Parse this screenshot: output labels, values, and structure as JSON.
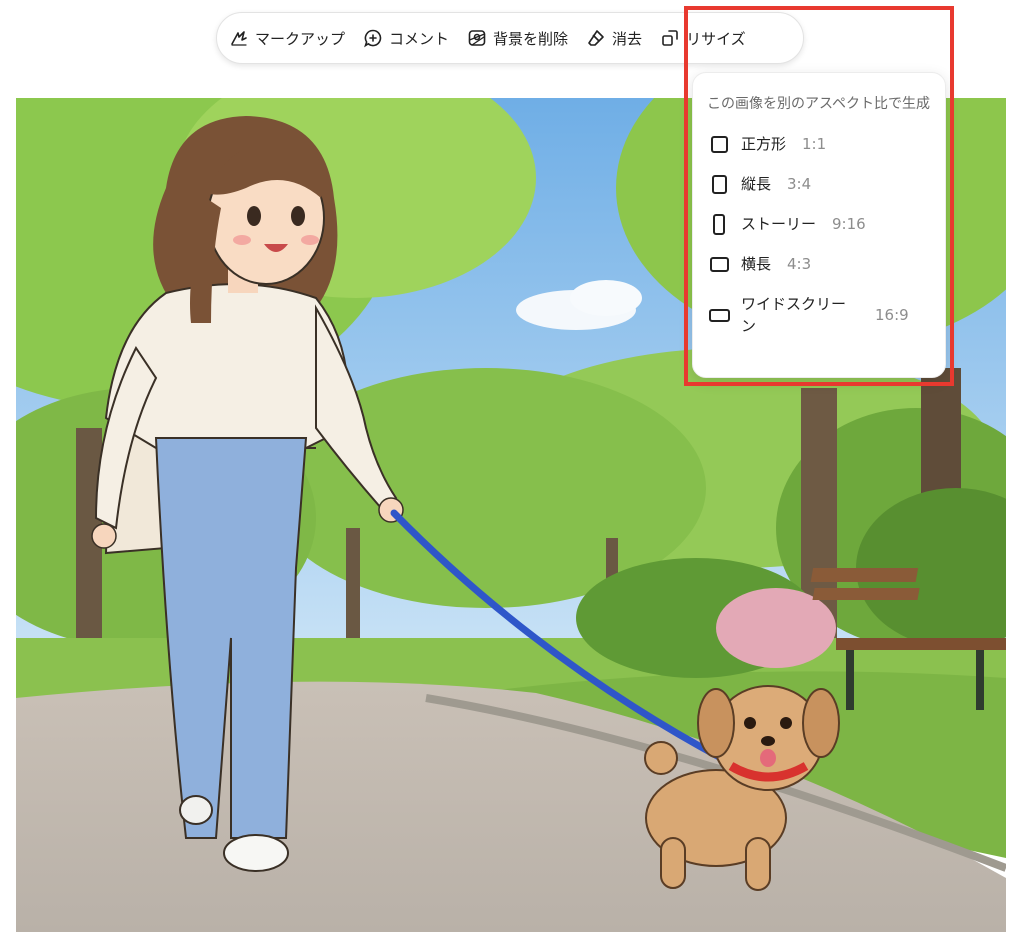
{
  "toolbar": {
    "markup": "マークアップ",
    "comment": "コメント",
    "remove_bg": "背景を削除",
    "erase": "消去",
    "resize": "リサイズ"
  },
  "resize_menu": {
    "title": "この画像を別のアスペクト比で生成",
    "options": [
      {
        "label": "正方形",
        "ratio": "1:1"
      },
      {
        "label": "縦長",
        "ratio": "3:4"
      },
      {
        "label": "ストーリー",
        "ratio": "9:16"
      },
      {
        "label": "横長",
        "ratio": "4:3"
      },
      {
        "label": "ワイドスクリーン",
        "ratio": "16:9"
      }
    ]
  },
  "colors": {
    "highlight": "#e8392f",
    "sky": "#8ec3ee",
    "foliage": "#7fc24a",
    "leash": "#2f56c9",
    "dog": "#d9a874",
    "jeans": "#8fb0dc"
  }
}
